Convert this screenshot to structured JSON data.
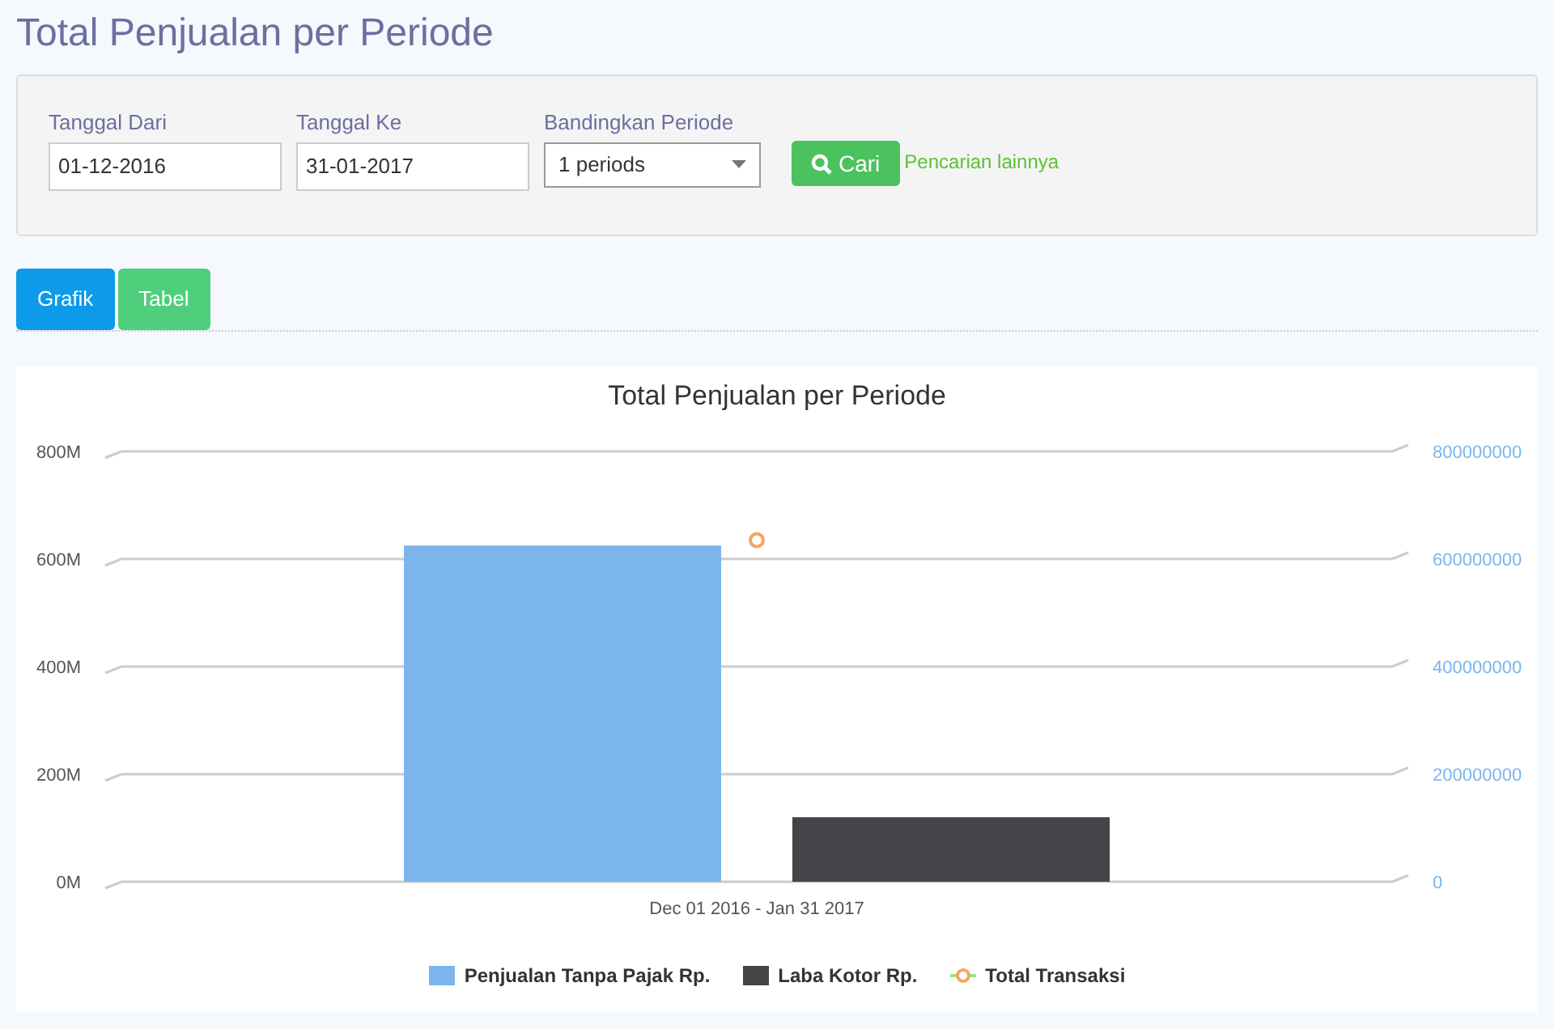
{
  "page_title": "Total Penjualan per Periode",
  "filters": [
    {
      "kind": "date",
      "label": "Tanggal Dari",
      "value": "01-12-2016"
    },
    {
      "kind": "date",
      "label": "Tanggal Ke",
      "value": "31-01-2017"
    },
    {
      "kind": "select",
      "label": "Bandingkan Periode",
      "value": "1 periods"
    }
  ],
  "search_button": "Cari",
  "more_search_link": "Pencarian lainnya",
  "tabs": [
    {
      "label": "Grafik",
      "selected": true
    },
    {
      "label": "Tabel",
      "selected": false
    }
  ],
  "chart": {
    "chart_data": {
      "type": "bar",
      "title": "Total Penjualan per Periode",
      "categories": [
        "Dec 01 2016 - Jan 31 2017"
      ],
      "legend": "bottom",
      "grid": true,
      "series": [
        {
          "name": "Penjualan Tanpa Pajak Rp.",
          "color": "#7cb5ec",
          "type": "bar",
          "values": [
            625000000
          ]
        },
        {
          "name": "Laba Kotor Rp.",
          "color": "#434348",
          "type": "bar",
          "values": [
            120000000
          ]
        },
        {
          "name": "Total Transaksi",
          "color": "#f7a35c",
          "type": "line",
          "marker": "o",
          "values": [
            635000000
          ]
        }
      ],
      "ylim": [
        0,
        800000000
      ],
      "yticks": [
        {
          "value": 0,
          "label": "0M"
        },
        {
          "value": 200000000,
          "label": "200M"
        },
        {
          "value": 400000000,
          "label": "400M"
        },
        {
          "value": 600000000,
          "label": "600M"
        },
        {
          "value": 800000000,
          "label": "800M"
        }
      ]
    },
    "right_axis_labels": [
      "800000000",
      "600000000",
      "400000000",
      "200000000",
      "0"
    ]
  }
}
